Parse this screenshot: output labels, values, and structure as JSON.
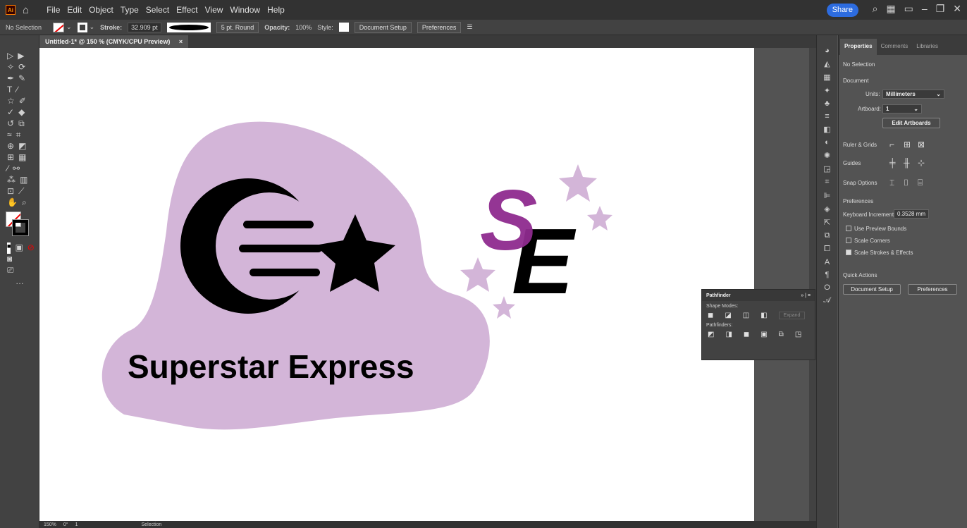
{
  "menubar": {
    "app_logo": "Ai",
    "menus": [
      "File",
      "Edit",
      "Object",
      "Type",
      "Select",
      "Effect",
      "View",
      "Window",
      "Help"
    ],
    "share_label": "Share"
  },
  "controlbar": {
    "selection_state": "No Selection",
    "stroke_label": "Stroke:",
    "stroke_value": "32.909 pt",
    "brush_label": "5 pt. Round",
    "opacity_label": "Opacity:",
    "opacity_value": "100%",
    "style_label": "Style:",
    "document_setup": "Document Setup",
    "preferences": "Preferences"
  },
  "document_tab": {
    "title": "Untitled-1* @ 150 % (CMYK/CPU Preview)",
    "close": "×"
  },
  "artwork": {
    "logo_text": "Superstar Express",
    "monogram": [
      "S",
      "E"
    ],
    "colors": {
      "lavender": "#d3b5d8",
      "purple": "#8e2a8e",
      "black": "#000000"
    }
  },
  "statusbar": {
    "zoom": "150%",
    "rotation": "0°",
    "artboard_num": "1",
    "tool": "Selection"
  },
  "properties_panel": {
    "tabs": [
      "Properties",
      "Comments",
      "Libraries"
    ],
    "selection": "No Selection",
    "document_header": "Document",
    "units_label": "Units:",
    "units_value": "Millimeters",
    "artboard_label": "Artboard:",
    "artboard_value": "1",
    "edit_artboards": "Edit Artboards",
    "ruler_grids": "Ruler & Grids",
    "guides": "Guides",
    "snap_options": "Snap Options",
    "preferences_header": "Preferences",
    "keyboard_increment_label": "Keyboard Increment:",
    "keyboard_increment_value": "0.3528 mm",
    "use_preview_bounds": "Use Preview Bounds",
    "scale_corners": "Scale Corners",
    "scale_strokes": "Scale Strokes & Effects",
    "quick_actions": "Quick Actions",
    "qa_document_setup": "Document Setup",
    "qa_preferences": "Preferences"
  },
  "pathfinder": {
    "title": "Pathfinder",
    "shape_modes": "Shape Modes:",
    "expand": "Expand",
    "pathfinders": "Pathfinders:"
  }
}
